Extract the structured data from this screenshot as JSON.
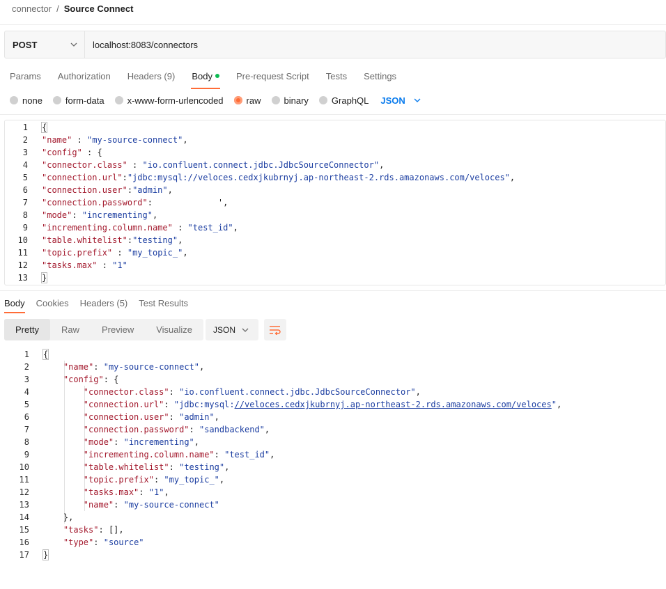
{
  "breadcrumb": {
    "parent": "connector",
    "separator": "/",
    "current": "Source Connect"
  },
  "request": {
    "method": "POST",
    "url": "localhost:8083/connectors"
  },
  "request_tabs": [
    {
      "label": "Params"
    },
    {
      "label": "Authorization"
    },
    {
      "label": "Headers (9)"
    },
    {
      "label": "Body",
      "active": true
    },
    {
      "label": "Pre-request Script"
    },
    {
      "label": "Tests"
    },
    {
      "label": "Settings"
    }
  ],
  "body_types": [
    {
      "label": "none"
    },
    {
      "label": "form-data"
    },
    {
      "label": "x-www-form-urlencoded"
    },
    {
      "label": "raw",
      "selected": true
    },
    {
      "label": "binary"
    },
    {
      "label": "GraphQL"
    }
  ],
  "body_language": "JSON",
  "request_body_lines": [
    "{",
    "\"name\" : \"my-source-connect\",",
    "\"config\" : {",
    "\"connector.class\" : \"io.confluent.connect.jdbc.JdbcSourceConnector\",",
    "\"connection.url\":\"jdbc:mysql://veloces.cedxjkubrnyj.ap-northeast-2.rds.amazonaws.com/veloces\",",
    "\"connection.user\":\"admin\",",
    "\"connection.password\":             ',",
    "\"mode\": \"incrementing\",",
    "\"incrementing.column.name\" : \"test_id\",",
    "\"table.whitelist\":\"testing\",",
    "\"topic.prefix\" : \"my_topic_\",",
    "\"tasks.max\" : \"1\"",
    "}"
  ],
  "response_tabs": [
    {
      "label": "Body",
      "active": true
    },
    {
      "label": "Cookies"
    },
    {
      "label": "Headers (5)"
    },
    {
      "label": "Test Results"
    }
  ],
  "view_modes": [
    {
      "label": "Pretty",
      "active": true
    },
    {
      "label": "Raw"
    },
    {
      "label": "Preview"
    },
    {
      "label": "Visualize"
    }
  ],
  "response_language": "JSON",
  "response_body_lines": [
    "{",
    "    \"name\": \"my-source-connect\",",
    "    \"config\": {",
    "        \"connector.class\": \"io.confluent.connect.jdbc.JdbcSourceConnector\",",
    "        \"connection.url\": \"jdbc:mysql://veloces.cedxjkubrnyj.ap-northeast-2.rds.amazonaws.com/veloces\",",
    "        \"connection.user\": \"admin\",",
    "        \"connection.password\": \"sandbackend\",",
    "        \"mode\": \"incrementing\",",
    "        \"incrementing.column.name\": \"test_id\",",
    "        \"table.whitelist\": \"testing\",",
    "        \"topic.prefix\": \"my_topic_\",",
    "        \"tasks.max\": \"1\",",
    "        \"name\": \"my-source-connect\"",
    "    },",
    "    \"tasks\": [],",
    "    \"type\": \"source\"",
    "}"
  ],
  "icons": {
    "method_dropdown": "chevron-down-icon",
    "language_dropdown": "chevron-down-icon",
    "wrap": "word-wrap-icon"
  },
  "colors": {
    "accent": "#ff6c37",
    "link": "#097bed",
    "json_key": "#a3192d",
    "json_string": "#1c3ea1",
    "status_dot": "#0cbb52"
  }
}
